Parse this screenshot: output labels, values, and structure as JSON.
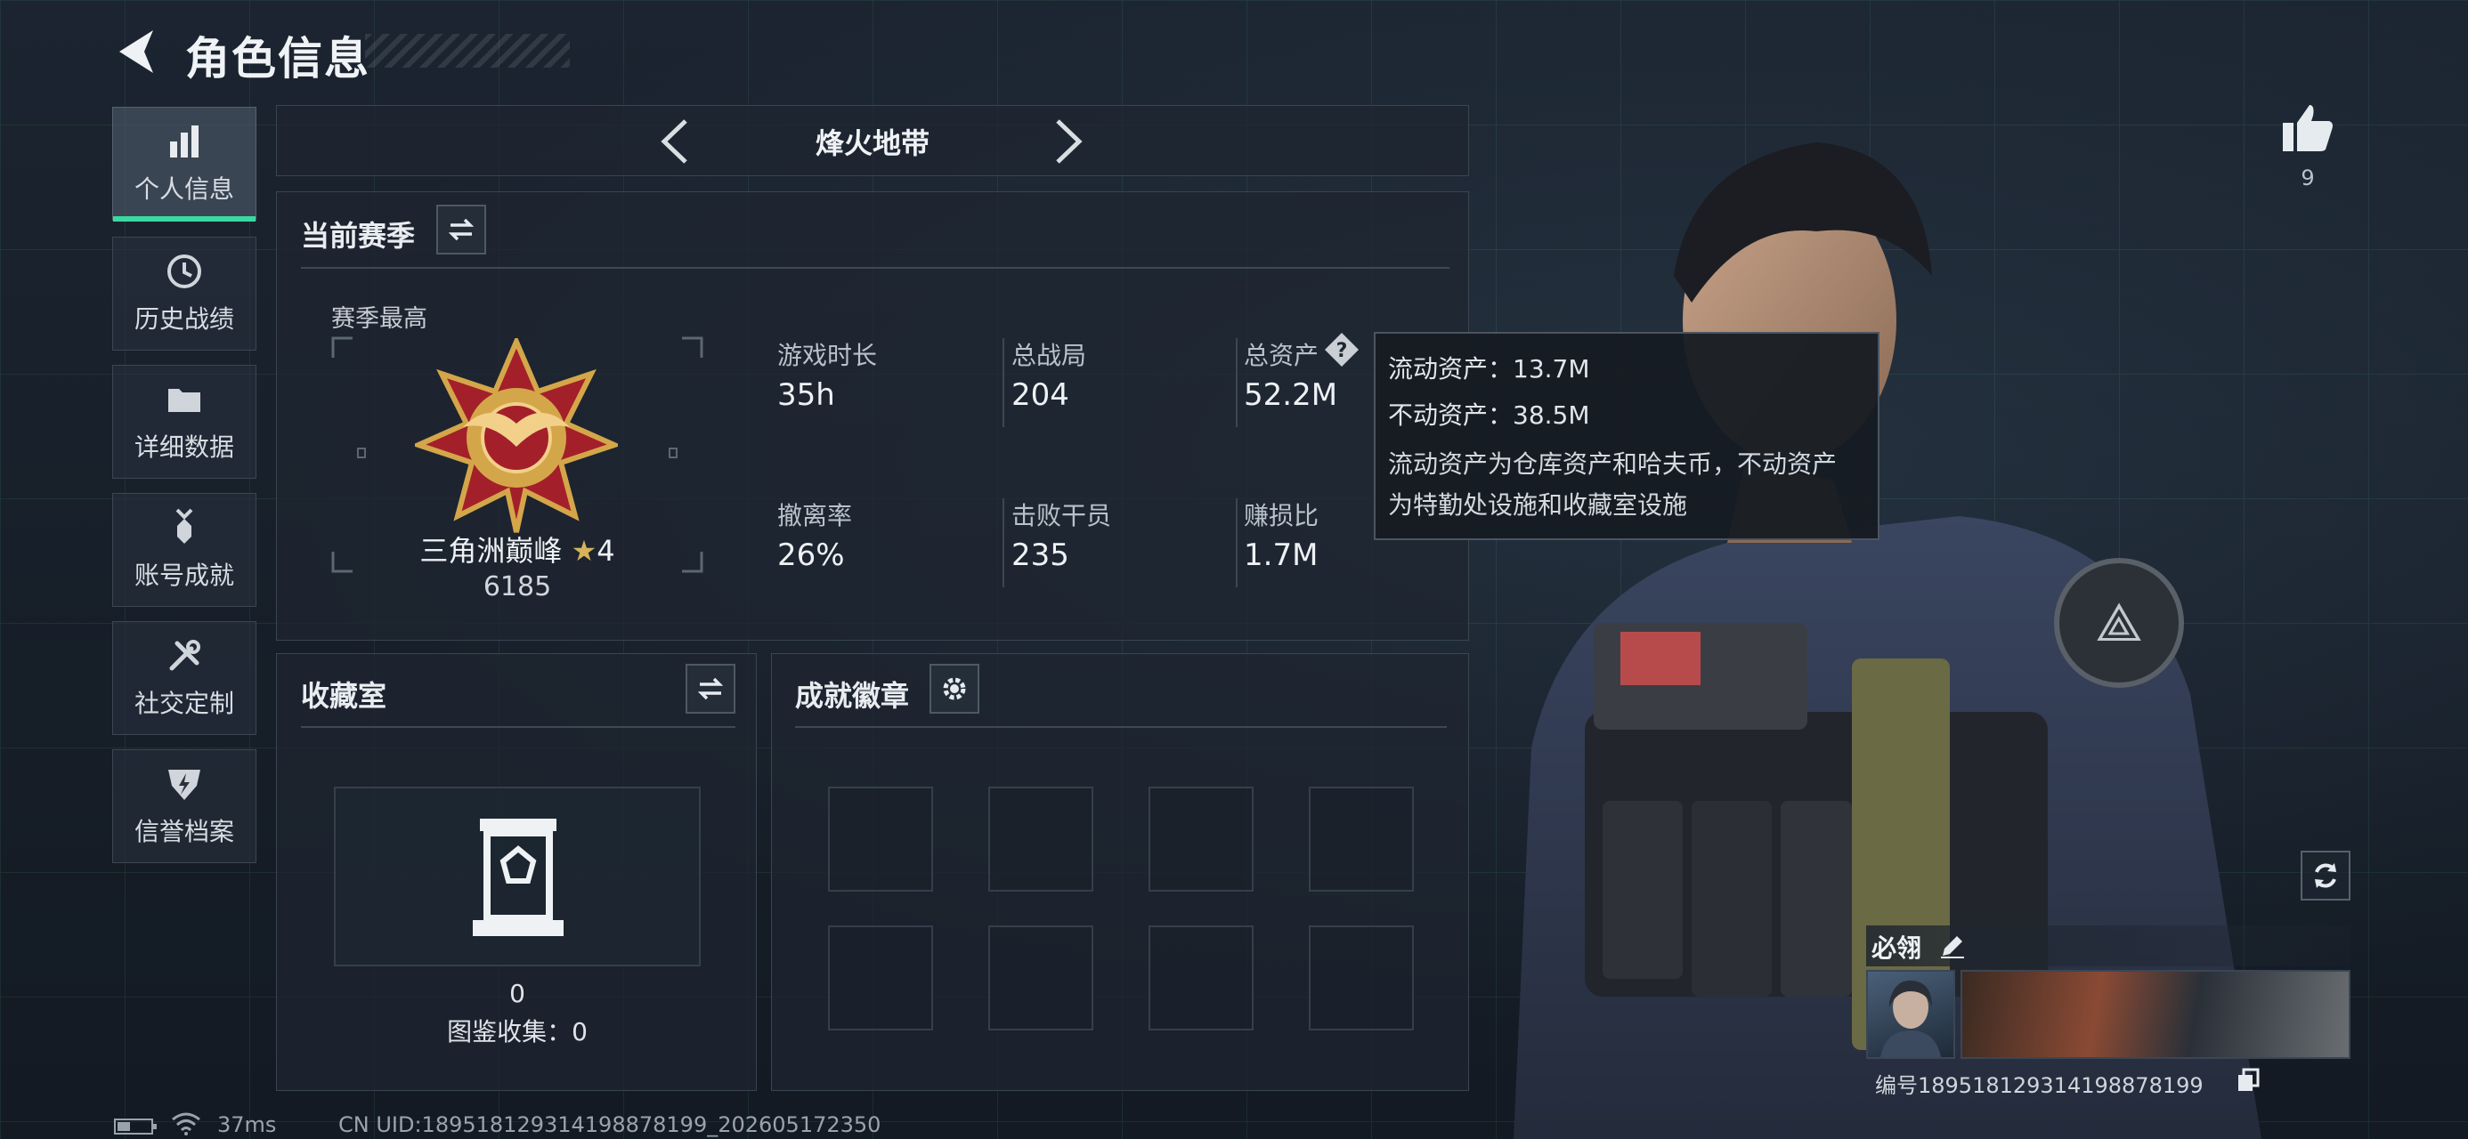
{
  "header": {
    "title": "角色信息"
  },
  "nav": [
    {
      "label": "个人信息",
      "icon": "bar-chart-icon",
      "active": true
    },
    {
      "label": "历史战绩",
      "icon": "history-clock-icon"
    },
    {
      "label": "详细数据",
      "icon": "folder-icon"
    },
    {
      "label": "账号成就",
      "icon": "medal-icon"
    },
    {
      "label": "社交定制",
      "icon": "tools-icon"
    },
    {
      "label": "信誉档案",
      "icon": "shield-lightning-icon"
    }
  ],
  "mode": {
    "name": "烽火地带"
  },
  "season": {
    "title": "当前赛季",
    "best_label": "赛季最高",
    "rank_name": "三角洲巅峰",
    "rank_stars": "4",
    "rank_score": "6185",
    "stats": [
      {
        "label": "游戏时长",
        "value": "35h"
      },
      {
        "label": "总战局",
        "value": "204"
      },
      {
        "label": "总资产",
        "value": "52.2M"
      },
      {
        "label": "撤离率",
        "value": "26%"
      },
      {
        "label": "击败干员",
        "value": "235"
      },
      {
        "label": "赚损比",
        "value": "1.7M"
      }
    ]
  },
  "tooltip": {
    "liquid": "流动资产：13.7M",
    "fixed": "不动资产：38.5M",
    "desc_line1": "流动资产为仓库资产和哈夫币，不动资产",
    "desc_line2": "为特勤处设施和收藏室设施"
  },
  "collection": {
    "title": "收藏室",
    "count": "0",
    "codex": "图鉴收集：0"
  },
  "badges": {
    "title": "成就徽章",
    "slots": 8
  },
  "likes": {
    "count": "9"
  },
  "player": {
    "name": "必翎",
    "uid_label": "编号1895181293141988781​99"
  },
  "status": {
    "ping": "37ms",
    "uid": "CN UID:18951812931419887819​9_202605172350"
  },
  "colors": {
    "accent": "#3bd9a0",
    "panel_bg": "#1e2630",
    "medal_gold": "#d4a64a",
    "medal_red": "#a3202a"
  }
}
